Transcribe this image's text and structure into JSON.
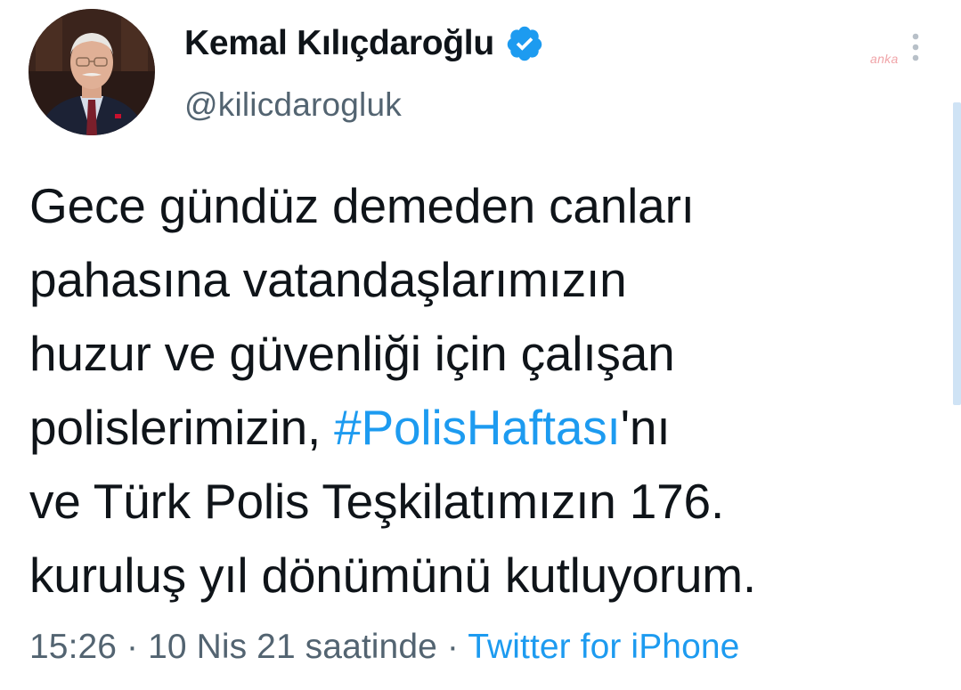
{
  "author": {
    "display_name": "Kemal Kılıçdaroğlu",
    "handle": "@kilicdarogluk",
    "verified": true
  },
  "watermark": "anka",
  "tweet": {
    "lines": [
      {
        "text": "Gece gündüz demeden canları"
      },
      {
        "text": "pahasına vatandaşlarımızın"
      },
      {
        "text": "huzur ve güvenliği için çalışan"
      },
      {
        "before": "polislerimizin, ",
        "hashtag": "#PolisHaftası",
        "after": "'nı"
      },
      {
        "text": "ve Türk Polis Teşkilatımızın 176."
      },
      {
        "text": "kuruluş yıl dönümünü kutluyorum."
      }
    ]
  },
  "meta": {
    "time": "15:26",
    "separator": "·",
    "date": "10 Nis 21 saatinde",
    "source": "Twitter for iPhone"
  },
  "colors": {
    "link": "#1d9bf0",
    "secondary_text": "#536471",
    "primary_text": "#0f1419",
    "verified_badge": "#1d9bf0"
  },
  "icons": [
    "verified-badge-icon",
    "more-options-icon"
  ]
}
